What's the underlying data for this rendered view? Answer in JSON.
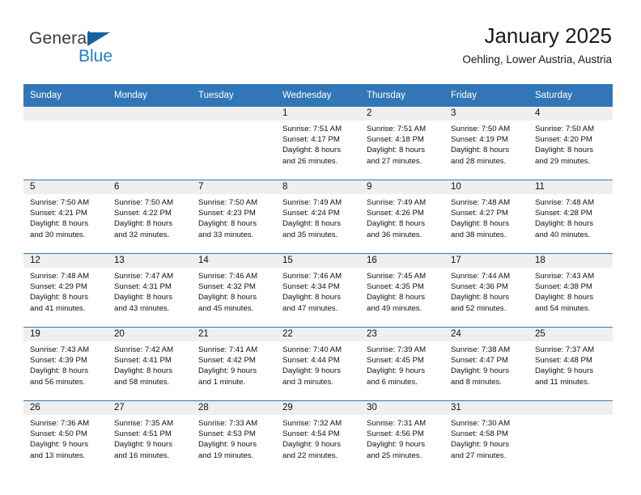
{
  "logo": {
    "word_one": "General",
    "word_two": "Blue",
    "triangle_icon": "triangle-icon",
    "brand_blue": "#1f7fd0",
    "brand_dark": "#3b3b3b"
  },
  "header": {
    "title": "January 2025",
    "subtitle": "Oehling, Lower Austria, Austria",
    "header_bg": "#3176b6",
    "daynum_bg": "#efeff0"
  },
  "weekday_headers": [
    "Sunday",
    "Monday",
    "Tuesday",
    "Wednesday",
    "Thursday",
    "Friday",
    "Saturday"
  ],
  "weeks": [
    [
      {
        "day": "",
        "sunrise": "",
        "sunset": "",
        "daylight_line1": "",
        "daylight_line2": ""
      },
      {
        "day": "",
        "sunrise": "",
        "sunset": "",
        "daylight_line1": "",
        "daylight_line2": ""
      },
      {
        "day": "",
        "sunrise": "",
        "sunset": "",
        "daylight_line1": "",
        "daylight_line2": ""
      },
      {
        "day": "1",
        "sunrise": "Sunrise: 7:51 AM",
        "sunset": "Sunset: 4:17 PM",
        "daylight_line1": "Daylight: 8 hours",
        "daylight_line2": "and 26 minutes."
      },
      {
        "day": "2",
        "sunrise": "Sunrise: 7:51 AM",
        "sunset": "Sunset: 4:18 PM",
        "daylight_line1": "Daylight: 8 hours",
        "daylight_line2": "and 27 minutes."
      },
      {
        "day": "3",
        "sunrise": "Sunrise: 7:50 AM",
        "sunset": "Sunset: 4:19 PM",
        "daylight_line1": "Daylight: 8 hours",
        "daylight_line2": "and 28 minutes."
      },
      {
        "day": "4",
        "sunrise": "Sunrise: 7:50 AM",
        "sunset": "Sunset: 4:20 PM",
        "daylight_line1": "Daylight: 8 hours",
        "daylight_line2": "and 29 minutes."
      }
    ],
    [
      {
        "day": "5",
        "sunrise": "Sunrise: 7:50 AM",
        "sunset": "Sunset: 4:21 PM",
        "daylight_line1": "Daylight: 8 hours",
        "daylight_line2": "and 30 minutes."
      },
      {
        "day": "6",
        "sunrise": "Sunrise: 7:50 AM",
        "sunset": "Sunset: 4:22 PM",
        "daylight_line1": "Daylight: 8 hours",
        "daylight_line2": "and 32 minutes."
      },
      {
        "day": "7",
        "sunrise": "Sunrise: 7:50 AM",
        "sunset": "Sunset: 4:23 PM",
        "daylight_line1": "Daylight: 8 hours",
        "daylight_line2": "and 33 minutes."
      },
      {
        "day": "8",
        "sunrise": "Sunrise: 7:49 AM",
        "sunset": "Sunset: 4:24 PM",
        "daylight_line1": "Daylight: 8 hours",
        "daylight_line2": "and 35 minutes."
      },
      {
        "day": "9",
        "sunrise": "Sunrise: 7:49 AM",
        "sunset": "Sunset: 4:26 PM",
        "daylight_line1": "Daylight: 8 hours",
        "daylight_line2": "and 36 minutes."
      },
      {
        "day": "10",
        "sunrise": "Sunrise: 7:48 AM",
        "sunset": "Sunset: 4:27 PM",
        "daylight_line1": "Daylight: 8 hours",
        "daylight_line2": "and 38 minutes."
      },
      {
        "day": "11",
        "sunrise": "Sunrise: 7:48 AM",
        "sunset": "Sunset: 4:28 PM",
        "daylight_line1": "Daylight: 8 hours",
        "daylight_line2": "and 40 minutes."
      }
    ],
    [
      {
        "day": "12",
        "sunrise": "Sunrise: 7:48 AM",
        "sunset": "Sunset: 4:29 PM",
        "daylight_line1": "Daylight: 8 hours",
        "daylight_line2": "and 41 minutes."
      },
      {
        "day": "13",
        "sunrise": "Sunrise: 7:47 AM",
        "sunset": "Sunset: 4:31 PM",
        "daylight_line1": "Daylight: 8 hours",
        "daylight_line2": "and 43 minutes."
      },
      {
        "day": "14",
        "sunrise": "Sunrise: 7:46 AM",
        "sunset": "Sunset: 4:32 PM",
        "daylight_line1": "Daylight: 8 hours",
        "daylight_line2": "and 45 minutes."
      },
      {
        "day": "15",
        "sunrise": "Sunrise: 7:46 AM",
        "sunset": "Sunset: 4:34 PM",
        "daylight_line1": "Daylight: 8 hours",
        "daylight_line2": "and 47 minutes."
      },
      {
        "day": "16",
        "sunrise": "Sunrise: 7:45 AM",
        "sunset": "Sunset: 4:35 PM",
        "daylight_line1": "Daylight: 8 hours",
        "daylight_line2": "and 49 minutes."
      },
      {
        "day": "17",
        "sunrise": "Sunrise: 7:44 AM",
        "sunset": "Sunset: 4:36 PM",
        "daylight_line1": "Daylight: 8 hours",
        "daylight_line2": "and 52 minutes."
      },
      {
        "day": "18",
        "sunrise": "Sunrise: 7:43 AM",
        "sunset": "Sunset: 4:38 PM",
        "daylight_line1": "Daylight: 8 hours",
        "daylight_line2": "and 54 minutes."
      }
    ],
    [
      {
        "day": "19",
        "sunrise": "Sunrise: 7:43 AM",
        "sunset": "Sunset: 4:39 PM",
        "daylight_line1": "Daylight: 8 hours",
        "daylight_line2": "and 56 minutes."
      },
      {
        "day": "20",
        "sunrise": "Sunrise: 7:42 AM",
        "sunset": "Sunset: 4:41 PM",
        "daylight_line1": "Daylight: 8 hours",
        "daylight_line2": "and 58 minutes."
      },
      {
        "day": "21",
        "sunrise": "Sunrise: 7:41 AM",
        "sunset": "Sunset: 4:42 PM",
        "daylight_line1": "Daylight: 9 hours",
        "daylight_line2": "and 1 minute."
      },
      {
        "day": "22",
        "sunrise": "Sunrise: 7:40 AM",
        "sunset": "Sunset: 4:44 PM",
        "daylight_line1": "Daylight: 9 hours",
        "daylight_line2": "and 3 minutes."
      },
      {
        "day": "23",
        "sunrise": "Sunrise: 7:39 AM",
        "sunset": "Sunset: 4:45 PM",
        "daylight_line1": "Daylight: 9 hours",
        "daylight_line2": "and 6 minutes."
      },
      {
        "day": "24",
        "sunrise": "Sunrise: 7:38 AM",
        "sunset": "Sunset: 4:47 PM",
        "daylight_line1": "Daylight: 9 hours",
        "daylight_line2": "and 8 minutes."
      },
      {
        "day": "25",
        "sunrise": "Sunrise: 7:37 AM",
        "sunset": "Sunset: 4:48 PM",
        "daylight_line1": "Daylight: 9 hours",
        "daylight_line2": "and 11 minutes."
      }
    ],
    [
      {
        "day": "26",
        "sunrise": "Sunrise: 7:36 AM",
        "sunset": "Sunset: 4:50 PM",
        "daylight_line1": "Daylight: 9 hours",
        "daylight_line2": "and 13 minutes."
      },
      {
        "day": "27",
        "sunrise": "Sunrise: 7:35 AM",
        "sunset": "Sunset: 4:51 PM",
        "daylight_line1": "Daylight: 9 hours",
        "daylight_line2": "and 16 minutes."
      },
      {
        "day": "28",
        "sunrise": "Sunrise: 7:33 AM",
        "sunset": "Sunset: 4:53 PM",
        "daylight_line1": "Daylight: 9 hours",
        "daylight_line2": "and 19 minutes."
      },
      {
        "day": "29",
        "sunrise": "Sunrise: 7:32 AM",
        "sunset": "Sunset: 4:54 PM",
        "daylight_line1": "Daylight: 9 hours",
        "daylight_line2": "and 22 minutes."
      },
      {
        "day": "30",
        "sunrise": "Sunrise: 7:31 AM",
        "sunset": "Sunset: 4:56 PM",
        "daylight_line1": "Daylight: 9 hours",
        "daylight_line2": "and 25 minutes."
      },
      {
        "day": "31",
        "sunrise": "Sunrise: 7:30 AM",
        "sunset": "Sunset: 4:58 PM",
        "daylight_line1": "Daylight: 9 hours",
        "daylight_line2": "and 27 minutes."
      },
      {
        "day": "",
        "sunrise": "",
        "sunset": "",
        "daylight_line1": "",
        "daylight_line2": ""
      }
    ]
  ]
}
